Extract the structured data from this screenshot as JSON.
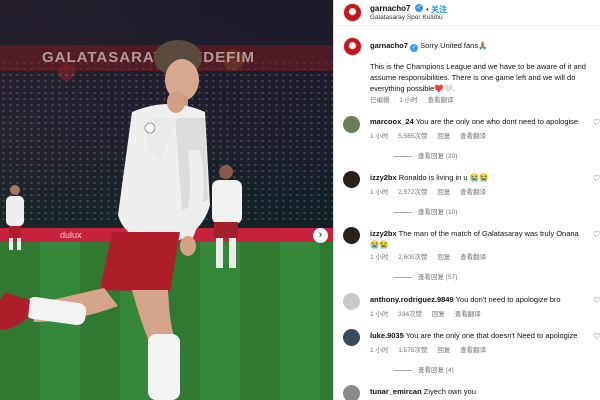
{
  "photo": {
    "banner_text": "GALATASARAY · HEDEFIM",
    "adboard_text": "dulux",
    "next_icon": "chevron-right-icon"
  },
  "post": {
    "author": "garnacho7",
    "verified": true,
    "separator": "•",
    "follow_label": "关注",
    "location": "Galatasaray Spor Kulübü",
    "caption_author": "garnacho7",
    "caption_line1": "Sorry United fans🙏🏽",
    "caption_body": "This is the Champions League and we have to be aware of it and assume responsibilities. There is one game left and we will do everything possible❤️🤍.",
    "caption_meta": {
      "edited": "已编辑",
      "dot": "·",
      "time": "1 小时",
      "translate": "查看翻译"
    }
  },
  "comments": [
    {
      "user": "marcoox_24",
      "text": "You are the only one who dont need to apologise",
      "time": "1 小时",
      "likes": "5,565次赞",
      "reply": "回复",
      "translate": "查看翻译",
      "replies": "查看回复 (20)",
      "avatar_color": "#6d7b5b"
    },
    {
      "user": "izzy2bx",
      "text": "Ronaldo is living in u 😭😭",
      "time": "1 小时",
      "likes": "2,572次赞",
      "reply": "回复",
      "translate": "查看翻译",
      "replies": "查看回复 (10)",
      "avatar_color": "#2b211c"
    },
    {
      "user": "izzy2bx",
      "text": "The man of the match of Galatasaray was truly Onana 😭😭",
      "time": "1 小时",
      "likes": "2,600次赞",
      "reply": "回复",
      "translate": "查看翻译",
      "replies": "查看回复 (57)",
      "avatar_color": "#2b211c"
    },
    {
      "user": "anthony.rodriguez.9849",
      "text": "You don't need to apologize bro",
      "time": "1 小时",
      "likes": "334次赞",
      "reply": "回复",
      "translate": "查看翻译",
      "replies": "",
      "avatar_color": "#c9c9c9"
    },
    {
      "user": "luke.9035",
      "text": "You are the only one that doesn't Need to apologize",
      "time": "1 小时",
      "likes": "1,575次赞",
      "reply": "回复",
      "translate": "查看翻译",
      "replies": "查看回复 (4)",
      "avatar_color": "#3a4a5a"
    },
    {
      "user": "tunar_emircan",
      "text": "Ziyech own you",
      "time": "",
      "likes": "",
      "reply": "",
      "translate": "",
      "replies": "",
      "avatar_color": "#8a8a8a"
    }
  ],
  "icons": {
    "like": "heart-outline-icon"
  }
}
